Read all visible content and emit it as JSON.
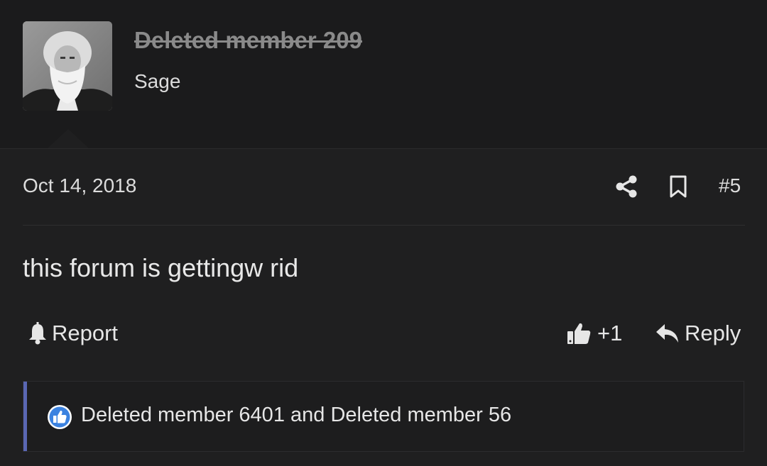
{
  "post": {
    "author": {
      "username": "Deleted member 209",
      "user_title": "Sage"
    },
    "date": "Oct 14, 2018",
    "post_number": "#5",
    "body": "this forum is gettingw rid",
    "actions": {
      "report_label": "Report",
      "like_count": "+1",
      "reply_label": "Reply"
    },
    "reactions": {
      "text": "Deleted member 6401 and Deleted member 56"
    }
  },
  "icons": {
    "share": "share-icon",
    "bookmark": "bookmark-icon",
    "report": "bell-icon",
    "like": "thumbs-up-icon",
    "reply": "reply-arrow-icon",
    "reaction": "like-reaction-icon"
  },
  "colors": {
    "background": "#1f1f20",
    "header_background": "#1b1b1c",
    "text": "#e6e6e6",
    "deleted_username": "#8a8a8a",
    "reaction_accent": "#5a67b3",
    "like_badge": "#3b82e0"
  }
}
